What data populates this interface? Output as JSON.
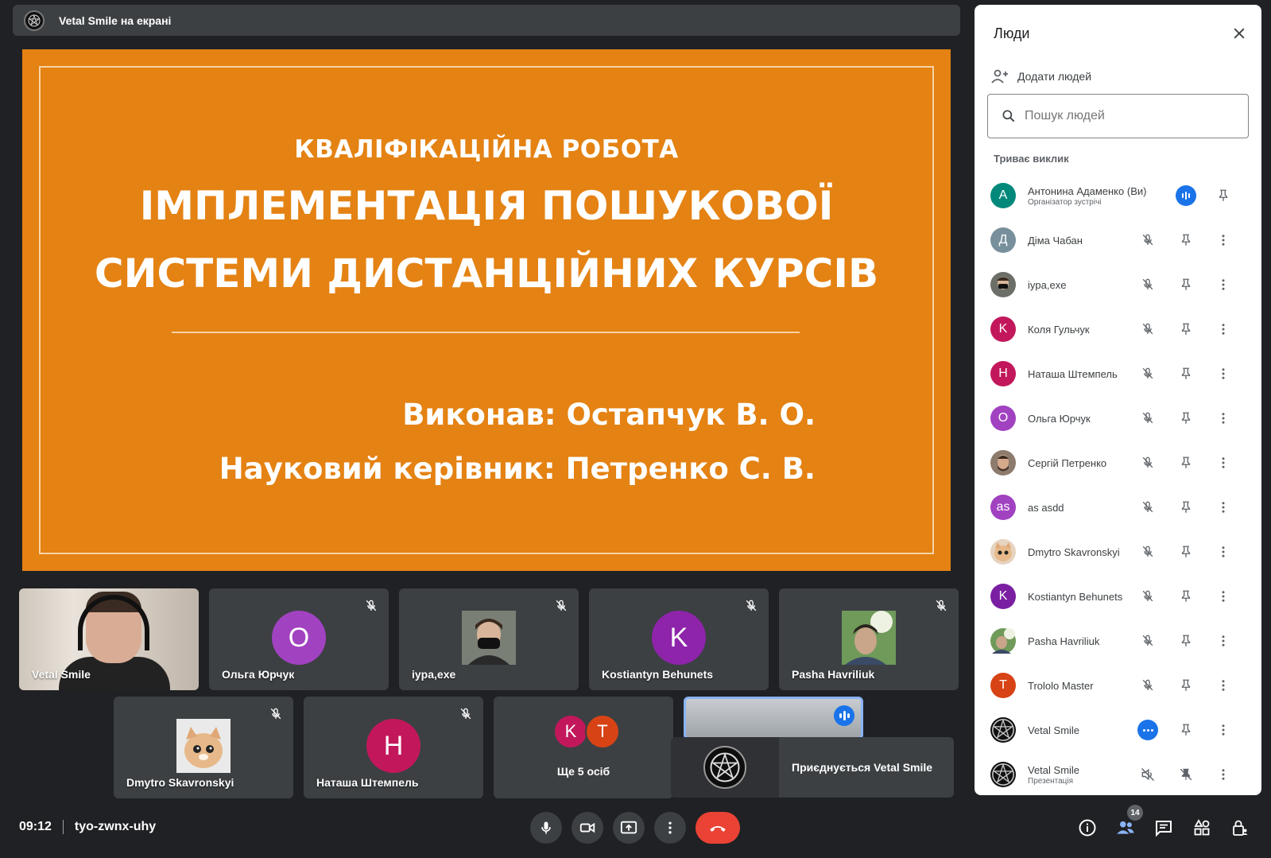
{
  "presenter_bar": {
    "label": "Vetal Smile на екрані"
  },
  "slide": {
    "kicker": "КВАЛІФІКАЦІЙНА РОБОТА",
    "title_line1": "ІМПЛЕМЕНТАЦІЯ ПОШУКОВОЇ",
    "title_line2": "СИСТЕМИ ДИСТАНЦІЙНИХ КУРСІВ",
    "author": "Виконав: Остапчук В. О.",
    "supervisor": "Науковий керівник: Петренко С. В."
  },
  "tiles": {
    "row1": [
      {
        "name": "Vetal Smile"
      },
      {
        "name": "Ольга Юрчук",
        "initial": "O",
        "color": "#a142c1"
      },
      {
        "name": "iypa,exe"
      },
      {
        "name": "Kostiantyn Behunets",
        "initial": "K",
        "color": "#8e24aa"
      },
      {
        "name": "Pasha Havriliuk"
      }
    ],
    "row2": [
      {
        "name": "Dmytro Skavronskyi"
      },
      {
        "name": "Наташа Штемпель",
        "initial": "Н",
        "color": "#c2185b"
      }
    ],
    "more": {
      "label": "Ще 5 осіб",
      "initials": [
        "K",
        "T"
      ],
      "colors": [
        "#c2185b",
        "#d84315"
      ]
    },
    "join_toast": "Приєднується Vetal Smile"
  },
  "bottom_bar": {
    "time": "09:12",
    "meeting_code": "tyo-zwnx-uhy",
    "people_count": "14"
  },
  "panel": {
    "title": "Люди",
    "add_people": "Додати людей",
    "search_placeholder": "Пошук людей",
    "section": "Триває виклик",
    "people": [
      {
        "name": "Антонина Адаменко (Ви)",
        "sub": "Організатор зустрічі",
        "initial": "A",
        "color": "#00897b"
      },
      {
        "name": "Діма Чабан",
        "initial": "Д",
        "color": "#78909c"
      },
      {
        "name": "iypa,exe"
      },
      {
        "name": "Коля Гульчук",
        "initial": "K",
        "color": "#c2185b"
      },
      {
        "name": "Наташа Штемпель",
        "initial": "Н",
        "color": "#c2185b"
      },
      {
        "name": "Ольга Юрчук",
        "initial": "O",
        "color": "#a142c1"
      },
      {
        "name": "Сергій Петренко"
      },
      {
        "name": "as asdd",
        "initial": "as",
        "color": "#a142c1"
      },
      {
        "name": "Dmytro Skavronskyi"
      },
      {
        "name": "Kostiantyn Behunets",
        "initial": "K",
        "color": "#7b1fa2"
      },
      {
        "name": "Pasha Havriliuk"
      },
      {
        "name": "Trololo Master",
        "initial": "T",
        "color": "#d84315"
      },
      {
        "name": "Vetal Smile"
      },
      {
        "name": "Vetal Smile",
        "sub": "Презентація"
      }
    ]
  }
}
